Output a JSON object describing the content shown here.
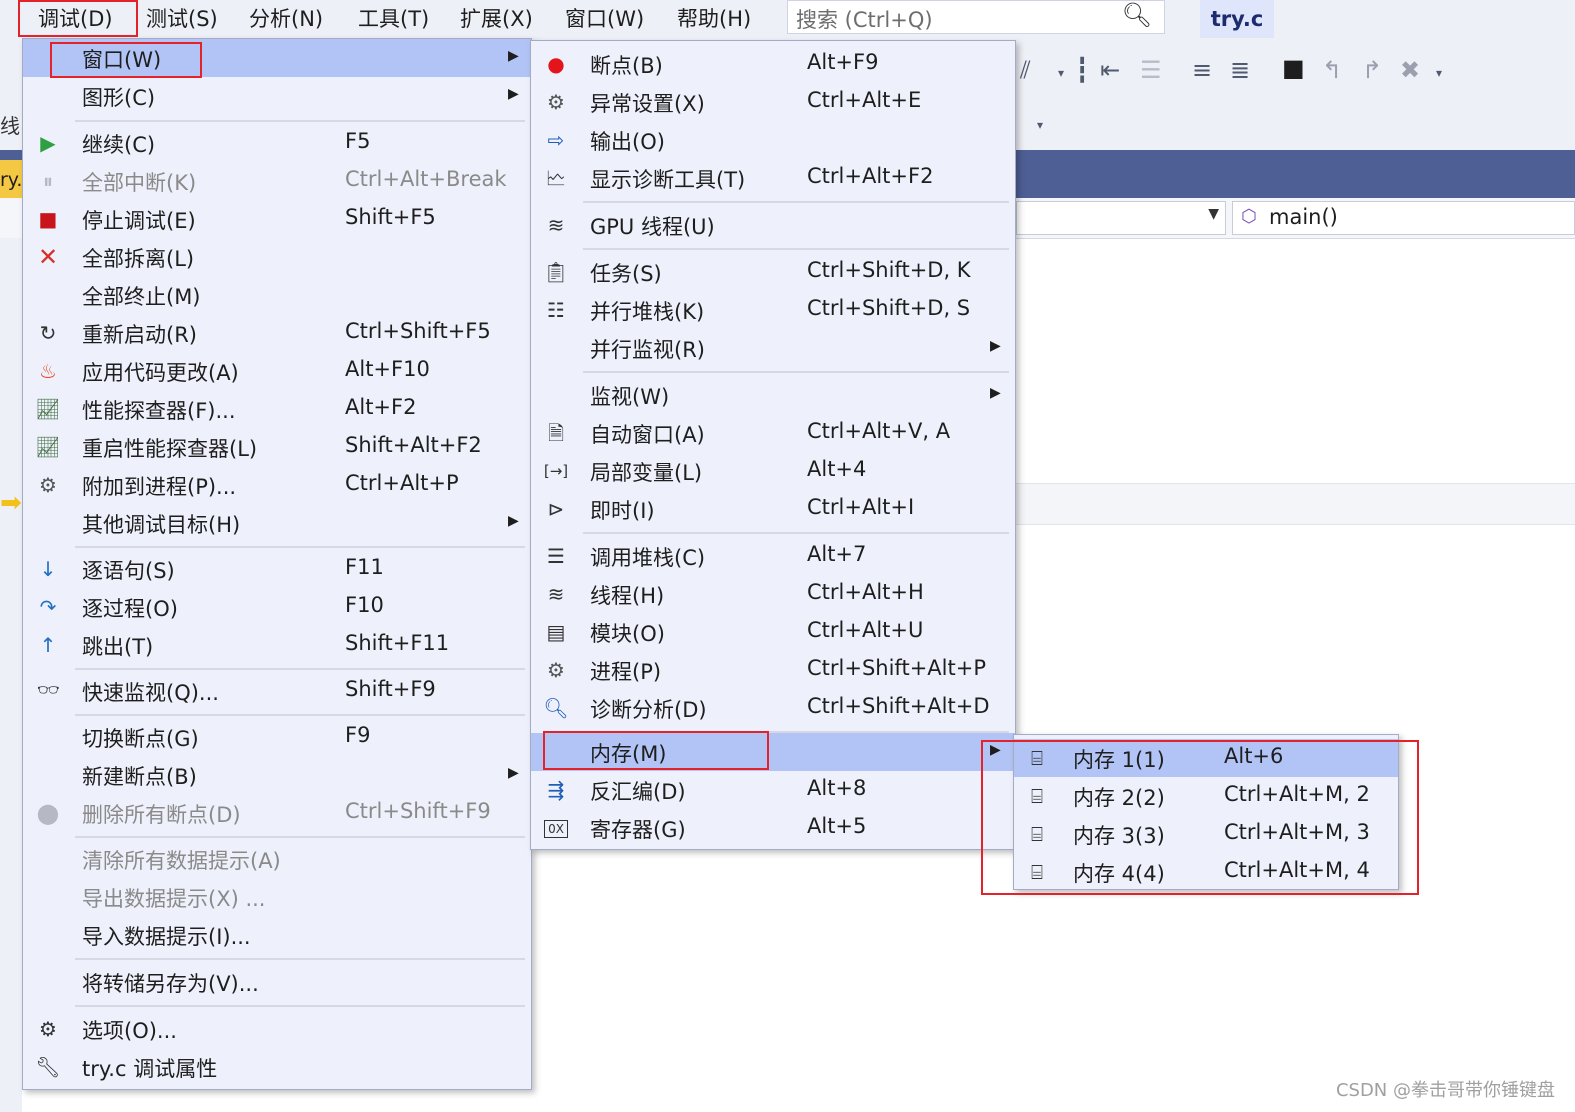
{
  "menubar": {
    "items": [
      "调试(D)",
      "测试(S)",
      "分析(N)",
      "工具(T)",
      "扩展(X)",
      "窗口(W)",
      "帮助(H)"
    ],
    "search_placeholder": "搜索 (Ctrl+Q)",
    "file_tab": "try.c"
  },
  "side": {
    "line_label": "线",
    "tab_stub": "ry."
  },
  "navigation": {
    "member": "main()"
  },
  "debug_menu": {
    "window": "窗口(W)",
    "graphics": "图形(C)",
    "continue": {
      "label": "继续(C)",
      "shortcut": "F5"
    },
    "break_all": {
      "label": "全部中断(K)",
      "shortcut": "Ctrl+Alt+Break"
    },
    "stop": {
      "label": "停止调试(E)",
      "shortcut": "Shift+F5"
    },
    "detach_all": "全部拆离(L)",
    "terminate_all": "全部终止(M)",
    "restart": {
      "label": "重新启动(R)",
      "shortcut": "Ctrl+Shift+F5"
    },
    "apply_code": {
      "label": "应用代码更改(A)",
      "shortcut": "Alt+F10"
    },
    "profiler": {
      "label": "性能探查器(F)...",
      "shortcut": "Alt+F2"
    },
    "relaunch_profiler": {
      "label": "重启性能探查器(L)",
      "shortcut": "Shift+Alt+F2"
    },
    "attach": {
      "label": "附加到进程(P)...",
      "shortcut": "Ctrl+Alt+P"
    },
    "other_targets": "其他调试目标(H)",
    "step_into": {
      "label": "逐语句(S)",
      "shortcut": "F11"
    },
    "step_over": {
      "label": "逐过程(O)",
      "shortcut": "F10"
    },
    "step_out": {
      "label": "跳出(T)",
      "shortcut": "Shift+F11"
    },
    "quickwatch": {
      "label": "快速监视(Q)...",
      "shortcut": "Shift+F9"
    },
    "toggle_bp": {
      "label": "切换断点(G)",
      "shortcut": "F9"
    },
    "new_bp": "新建断点(B)",
    "delete_bps": {
      "label": "删除所有断点(D)",
      "shortcut": "Ctrl+Shift+F9"
    },
    "clear_datatips": "清除所有数据提示(A)",
    "export_datatips": "导出数据提示(X) ...",
    "import_datatips": "导入数据提示(I)...",
    "save_dump": "将转储另存为(V)...",
    "options": "选项(O)...",
    "properties": "try.c 调试属性"
  },
  "window_menu": {
    "breakpoints": {
      "label": "断点(B)",
      "shortcut": "Alt+F9"
    },
    "exceptions": {
      "label": "异常设置(X)",
      "shortcut": "Ctrl+Alt+E"
    },
    "output": {
      "label": "输出(O)"
    },
    "diag_tools": {
      "label": "显示诊断工具(T)",
      "shortcut": "Ctrl+Alt+F2"
    },
    "gpu_threads": {
      "label": "GPU 线程(U)"
    },
    "tasks": {
      "label": "任务(S)",
      "shortcut": "Ctrl+Shift+D, K"
    },
    "parallel_stacks": {
      "label": "并行堆栈(K)",
      "shortcut": "Ctrl+Shift+D, S"
    },
    "parallel_watch": {
      "label": "并行监视(R)"
    },
    "watch": {
      "label": "监视(W)"
    },
    "autos": {
      "label": "自动窗口(A)",
      "shortcut": "Ctrl+Alt+V, A"
    },
    "locals": {
      "label": "局部变量(L)",
      "shortcut": "Alt+4"
    },
    "immediate": {
      "label": "即时(I)",
      "shortcut": "Ctrl+Alt+I"
    },
    "call_stack": {
      "label": "调用堆栈(C)",
      "shortcut": "Alt+7"
    },
    "threads": {
      "label": "线程(H)",
      "shortcut": "Ctrl+Alt+H"
    },
    "modules": {
      "label": "模块(O)",
      "shortcut": "Ctrl+Alt+U"
    },
    "processes": {
      "label": "进程(P)",
      "shortcut": "Ctrl+Shift+Alt+P"
    },
    "diag_analysis": {
      "label": "诊断分析(D)",
      "shortcut": "Ctrl+Shift+Alt+D"
    },
    "memory": {
      "label": "内存(M)"
    },
    "disassembly": {
      "label": "反汇编(D)",
      "shortcut": "Alt+8"
    },
    "registers": {
      "label": "寄存器(G)",
      "shortcut": "Alt+5"
    }
  },
  "memory_menu": {
    "m1": {
      "label": "内存 1(1)",
      "shortcut": "Alt+6"
    },
    "m2": {
      "label": "内存 2(2)",
      "shortcut": "Ctrl+Alt+M, 2"
    },
    "m3": {
      "label": "内存 3(3)",
      "shortcut": "Ctrl+Alt+M, 3"
    },
    "m4": {
      "label": "内存 4(4)",
      "shortcut": "Ctrl+Alt+M, 4"
    }
  },
  "watermark": "CSDN @拳击哥带你锤键盘",
  "colors": {
    "highlight": "#b2c4f5",
    "menu_bg": "#eef1fb",
    "annotation_red": "#e3222a",
    "doc_bar": "#4e5f96"
  }
}
